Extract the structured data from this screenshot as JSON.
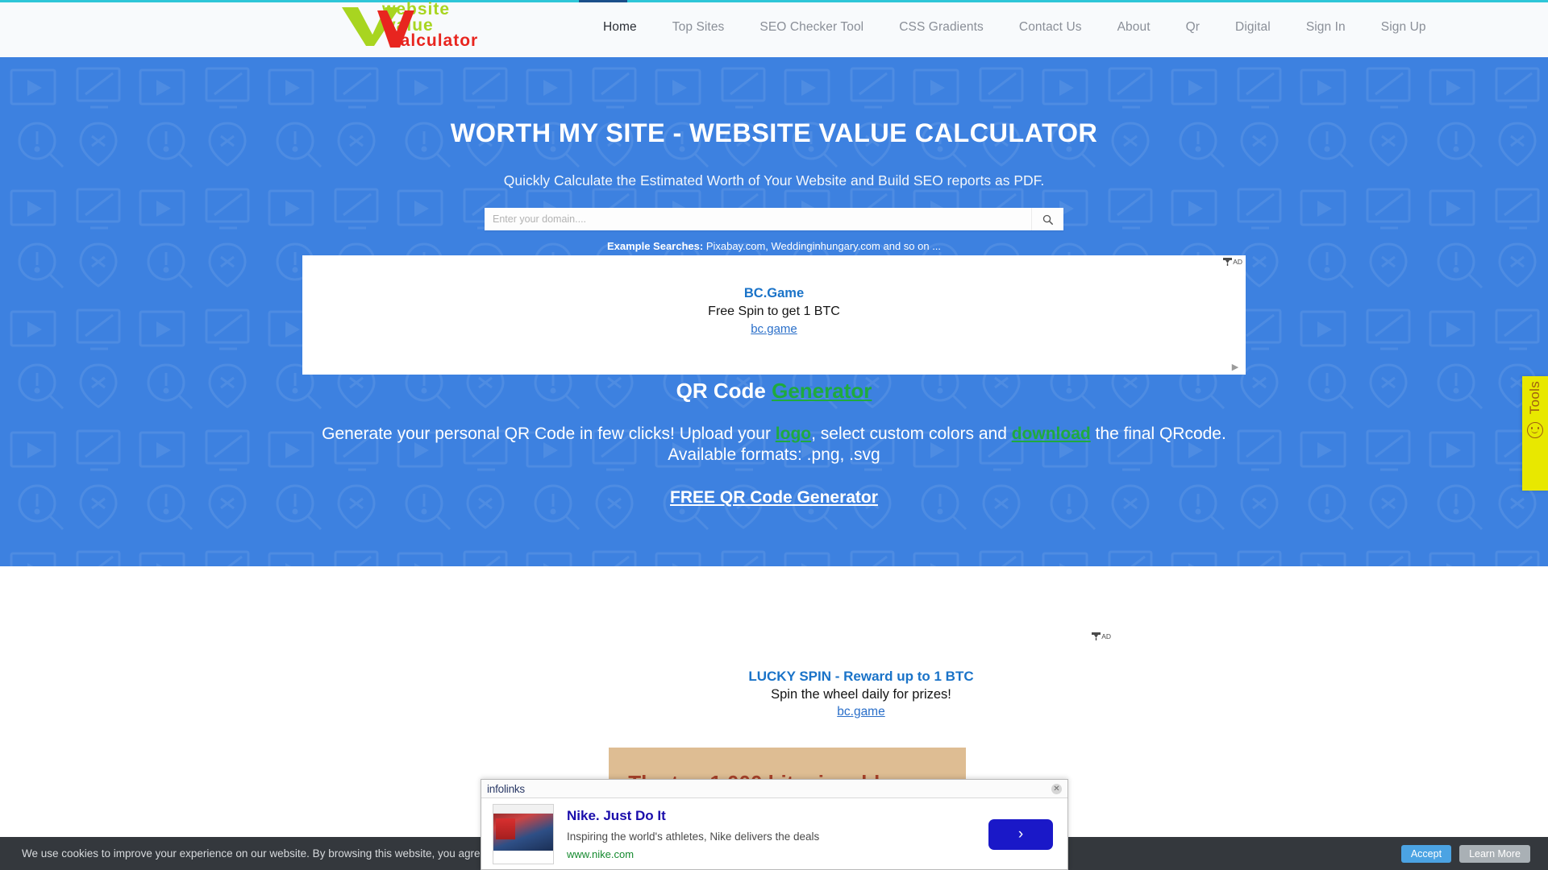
{
  "header": {
    "logo_alt": "website value calculator",
    "logo_line1": "website",
    "logo_line2": "value",
    "logo_line3": "calculator",
    "nav": [
      {
        "label": "Home",
        "active": true
      },
      {
        "label": "Top Sites",
        "active": false
      },
      {
        "label": "SEO Checker Tool",
        "active": false
      },
      {
        "label": "CSS Gradients",
        "active": false
      },
      {
        "label": "Contact Us",
        "active": false
      },
      {
        "label": "About",
        "active": false
      },
      {
        "label": "Qr",
        "active": false
      },
      {
        "label": "Digital",
        "active": false
      },
      {
        "label": "Sign In",
        "active": false
      },
      {
        "label": "Sign Up",
        "active": false
      }
    ]
  },
  "hero": {
    "title": "Worth My Site - Website Value Calculator",
    "subtitle": "Quickly Calculate the Estimated Worth of Your Website and Build SEO reports as PDF.",
    "search_placeholder": "Enter your domain....",
    "search_value": "",
    "search_icon": "search-icon",
    "example_label": "Example Searches:",
    "example_value": "Pixabay.com, Weddinginhungary.com and so on ...",
    "bg_color": "#3d81e0"
  },
  "ad_top": {
    "badge": "AD",
    "title": "BC.Game",
    "description": "Free Spin to get 1 BTC",
    "url": "bc.game",
    "title_color": "#1a73c8"
  },
  "qr_section": {
    "heading_prefix": "QR Code ",
    "heading_link": "Generator",
    "desc_1": "Generate your personal QR Code in few clicks! Upload your ",
    "desc_link_1": "logo",
    "desc_2": ", select custom colors and ",
    "desc_link_2": "download",
    "desc_3": " the final QRcode. Available formats: .png, .svg",
    "cta": "FREE QR Code Generator",
    "link_color": "#1faa3e"
  },
  "ad_bottom": {
    "badge": "AD",
    "title": "LUCKY SPIN - Reward up to 1 BTC",
    "description": "Spin the wheel daily for prizes!",
    "url": "bc.game"
  },
  "banner": {
    "text": "The top 1,000 bitcoin addresses",
    "bg_color": "#debd93",
    "text_color": "#a8422a"
  },
  "infolinks": {
    "brand": "infolinks",
    "close_icon": "close-icon",
    "ad_title": "Nike. Just Do It",
    "ad_desc": "Inspiring the world's athletes, Nike delivers the deals",
    "ad_url": "www.nike.com",
    "cta_icon": "chevron-right-icon"
  },
  "cookie_bar": {
    "text": "We use cookies to improve your experience on our website. By browsing this website, you agree to our use of cookies.",
    "accept_label": "Accept",
    "learn_label": "Learn More",
    "accept_color": "#4ba3e3"
  },
  "tools_tab": {
    "label": "Tools",
    "icon": "smiley-icon",
    "bg_color": "#e8e800"
  }
}
